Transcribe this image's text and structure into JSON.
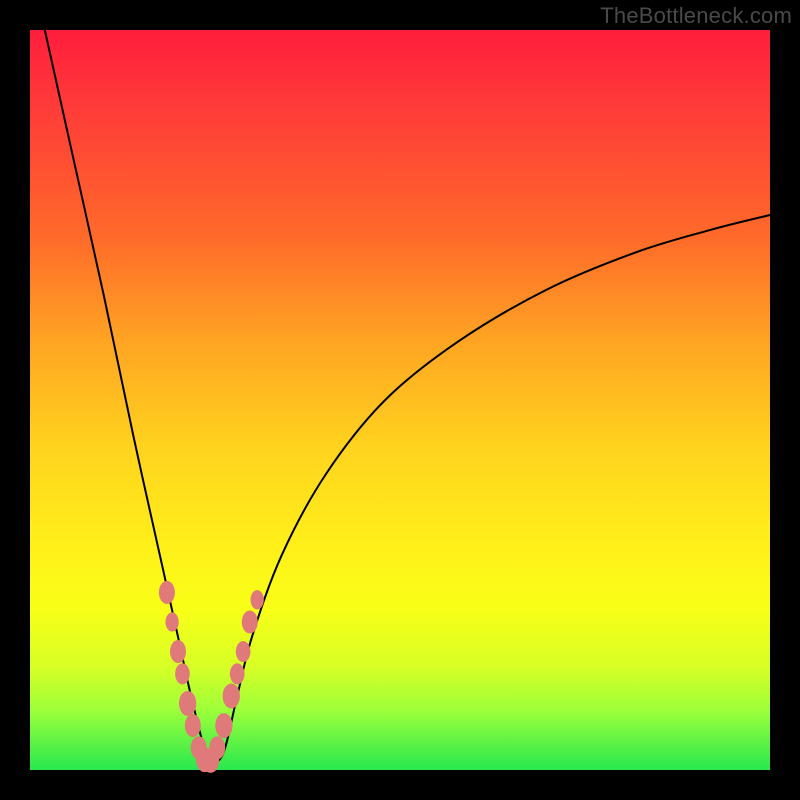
{
  "watermark": "TheBottleneck.com",
  "colors": {
    "frame_bg": "#000000",
    "gradient_stops": [
      "#ff1e3c",
      "#ff3a3a",
      "#ff6a2a",
      "#ffa423",
      "#ffd21e",
      "#fff01a",
      "#f9ff17",
      "#d8ff25",
      "#9cff3a",
      "#27e84e"
    ],
    "curve_stroke": "#000000",
    "bead_fill": "#e07a7a"
  },
  "chart_data": {
    "type": "line",
    "title": "",
    "xlabel": "",
    "ylabel": "",
    "x_range": [
      0,
      100
    ],
    "y_range": [
      0,
      100
    ],
    "note": "Values are read off the plotted curve in a 0–100 percent coordinate space (x left→right, y bottom→top). Bottleneck-style V curve with minimum ≈0 near x≈24, rising to ~100 at x=0 and ~75 at x=100. Salmon bead clusters are plotted along the two branches near the trough.",
    "series": [
      {
        "name": "bottleneck_curve",
        "x": [
          2,
          6,
          10,
          14,
          18,
          20,
          22,
          24,
          26,
          28,
          30,
          34,
          40,
          48,
          58,
          70,
          82,
          92,
          100
        ],
        "y": [
          100,
          82,
          64,
          45,
          27,
          18,
          9,
          2,
          2,
          10,
          18,
          29,
          40,
          50,
          58,
          65,
          70,
          73,
          75
        ]
      }
    ],
    "beads_left_branch": [
      {
        "x": 18.5,
        "y": 24,
        "r": 1.2
      },
      {
        "x": 19.2,
        "y": 20,
        "r": 1.0
      },
      {
        "x": 20.0,
        "y": 16,
        "r": 1.2
      },
      {
        "x": 20.6,
        "y": 13,
        "r": 1.1
      },
      {
        "x": 21.3,
        "y": 9,
        "r": 1.3
      },
      {
        "x": 22.0,
        "y": 6,
        "r": 1.2
      },
      {
        "x": 22.8,
        "y": 3,
        "r": 1.2
      }
    ],
    "beads_right_branch": [
      {
        "x": 25.3,
        "y": 3,
        "r": 1.2
      },
      {
        "x": 26.2,
        "y": 6,
        "r": 1.3
      },
      {
        "x": 27.2,
        "y": 10,
        "r": 1.3
      },
      {
        "x": 28.0,
        "y": 13,
        "r": 1.1
      },
      {
        "x": 28.8,
        "y": 16,
        "r": 1.1
      },
      {
        "x": 29.7,
        "y": 20,
        "r": 1.2
      },
      {
        "x": 30.7,
        "y": 23,
        "r": 1.0
      }
    ],
    "beads_trough": [
      {
        "x": 23.6,
        "y": 1.4,
        "r": 1.3
      },
      {
        "x": 24.4,
        "y": 1.3,
        "r": 1.3
      }
    ]
  }
}
